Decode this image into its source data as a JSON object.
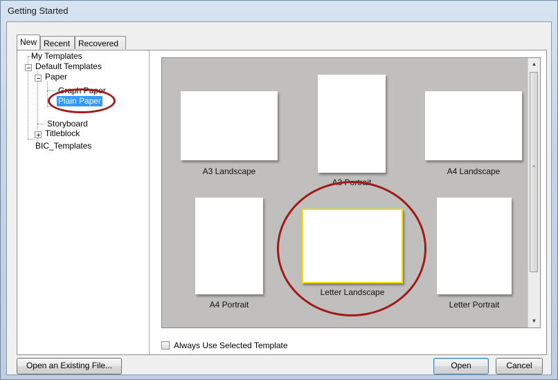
{
  "window": {
    "title": "Getting Started"
  },
  "tabs": [
    {
      "label": "New",
      "active": true
    },
    {
      "label": "Recent",
      "active": false
    },
    {
      "label": "Recovered",
      "active": false
    }
  ],
  "tree": {
    "my_templates": "My Templates",
    "default_templates": "Default Templates",
    "paper": "Paper",
    "graph_paper": "Graph Paper",
    "plain_paper": "Plain Paper",
    "storyboard": "Storyboard",
    "titleblock": "Titleblock",
    "bic_templates": "BIC_Templates",
    "selected": "Plain Paper"
  },
  "templates": [
    {
      "label": "A3 Landscape"
    },
    {
      "label": "A3 Portrait"
    },
    {
      "label": "A4 Landscape"
    },
    {
      "label": "A4 Portrait"
    },
    {
      "label": "Letter Landscape",
      "selected": true
    },
    {
      "label": "Letter Portrait"
    }
  ],
  "options": {
    "always_use_selected": "Always Use Selected Template",
    "always_use_checked": false
  },
  "buttons": {
    "open_existing": "Open an Existing File...",
    "open": "Open",
    "cancel": "Cancel"
  },
  "colors": {
    "highlight_circle": "#a01a1a",
    "selection": "#3399ff",
    "selected_card_border": "#f2e200"
  }
}
